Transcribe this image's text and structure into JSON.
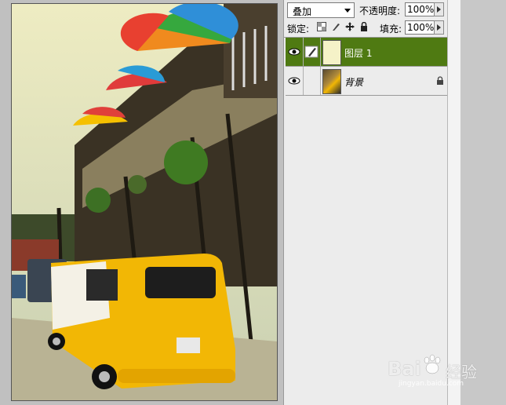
{
  "layers_panel": {
    "blend_mode": "叠加",
    "opacity_label": "不透明度:",
    "opacity_value": "100%",
    "lock_label": "锁定:",
    "fill_label": "填充:",
    "fill_value": "100%",
    "layers": [
      {
        "name": "图层 1",
        "selected": true,
        "visible": true,
        "thumb_color": "#f5f2c8"
      },
      {
        "name": "背景",
        "selected": false,
        "visible": true,
        "locked": true
      }
    ]
  },
  "watermark": {
    "brand": "Bai",
    "brand2": "经验",
    "url": "jingyan.baidu.com"
  },
  "colors": {
    "selected_layer": "#4f7a12",
    "panel_bg": "#ececec",
    "van_yellow": "#f2b705"
  }
}
